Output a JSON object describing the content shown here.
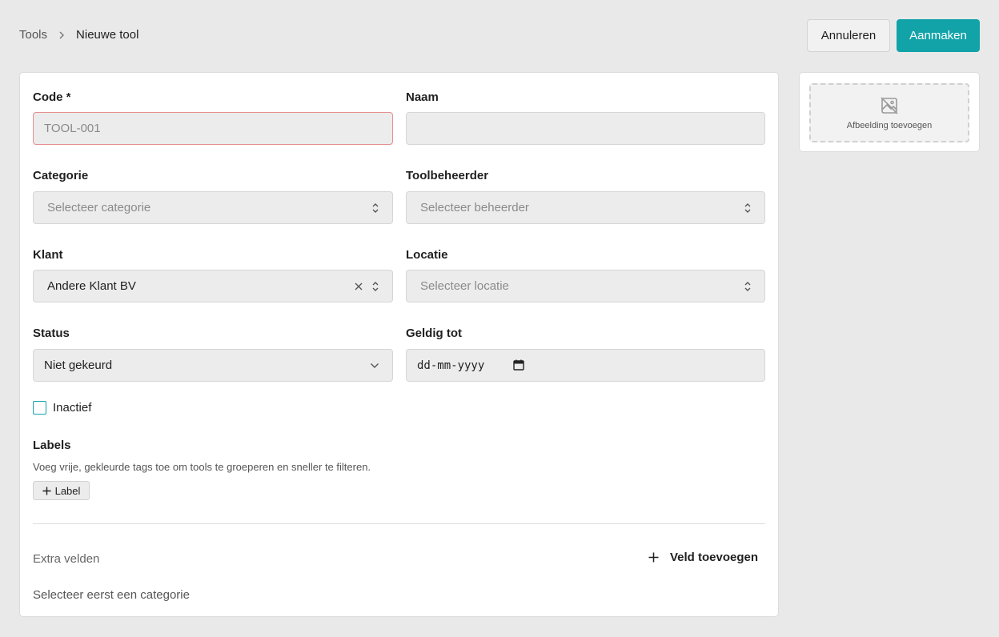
{
  "breadcrumb": {
    "parent": "Tools",
    "current": "Nieuwe tool"
  },
  "actions": {
    "cancel_label": "Annuleren",
    "create_label": "Aanmaken"
  },
  "colors": {
    "accent": "#12a3a9",
    "error_border": "#e58f8f",
    "page_bg": "#e9e9e9"
  },
  "form": {
    "code": {
      "label": "Code *",
      "value": "",
      "placeholder": "TOOL-001"
    },
    "naam": {
      "label": "Naam",
      "value": ""
    },
    "categorie": {
      "label": "Categorie",
      "placeholder": "Selecteer categorie"
    },
    "toolbeheerder": {
      "label": "Toolbeheerder",
      "placeholder": "Selecteer beheerder"
    },
    "klant": {
      "label": "Klant",
      "value": "Andere Klant BV"
    },
    "locatie": {
      "label": "Locatie",
      "placeholder": "Selecteer locatie"
    },
    "status": {
      "label": "Status",
      "value": "Niet gekeurd"
    },
    "geldig_tot": {
      "label": "Geldig tot",
      "placeholder": "dd-mm-yyyy"
    },
    "inactief": {
      "label": "Inactief",
      "checked": false
    }
  },
  "labels": {
    "title": "Labels",
    "help": "Voeg vrije, gekleurde tags toe om tools te groeperen en sneller te filteren.",
    "add_label": "Label"
  },
  "extra_fields": {
    "title": "Extra velden",
    "add_label": "Veld toevoegen",
    "empty_text": "Selecteer eerst een categorie"
  },
  "image": {
    "add_label": "Afbeelding toevoegen",
    "icon": "image-off-icon"
  }
}
